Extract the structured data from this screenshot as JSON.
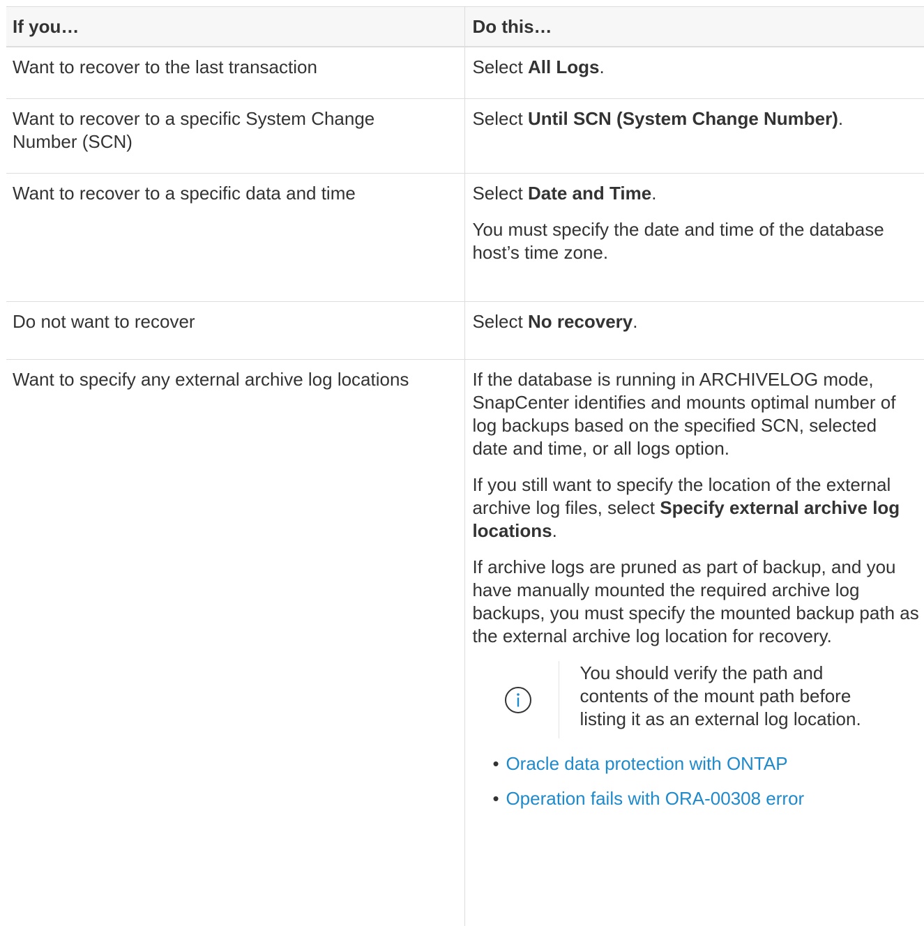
{
  "header": {
    "col1": "If you…",
    "col2": "Do this…"
  },
  "rows": [
    {
      "condition": "Want to recover to the last transaction",
      "action_prefix": "Select ",
      "action_bold": "All Logs",
      "action_suffix": "."
    },
    {
      "condition": "Want to recover to a specific System Change Number (SCN)",
      "action_prefix": "Select ",
      "action_bold": "Until SCN (System Change Number)",
      "action_suffix": "."
    },
    {
      "condition": "Want to recover to a specific data and time",
      "action_prefix": "Select ",
      "action_bold": "Date and Time",
      "action_suffix": ".",
      "extra": "You must specify the date and time of the database host’s time zone."
    },
    {
      "condition": "Do not want to recover",
      "action_prefix": "Select ",
      "action_bold": "No recovery",
      "action_suffix": "."
    },
    {
      "condition": "Want to specify any external archive log locations",
      "para1": "If the database is running in ARCHIVELOG mode, SnapCenter identifies and mounts optimal number of log backups based on the specified SCN, selected date and time, or all logs option.",
      "para2_prefix": "If you still want to specify the location of the external archive log files, select ",
      "para2_bold": "Specify external archive log locations",
      "para2_suffix": ".",
      "para3": "If archive logs are pruned as part of backup, and you have manually mounted the required archive log backups, you must specify the mounted backup path as the external archive log location for recovery.",
      "note": {
        "icon": "info-icon",
        "text": "You should verify the path and contents of the mount path before listing it as an external log location."
      },
      "links": [
        "Oracle data protection with ONTAP",
        "Operation fails with ORA-00308 error"
      ]
    }
  ],
  "colors": {
    "link": "#1f8acb",
    "text": "#333333",
    "border": "#dddddd",
    "header_bg": "#f7f7f7"
  }
}
